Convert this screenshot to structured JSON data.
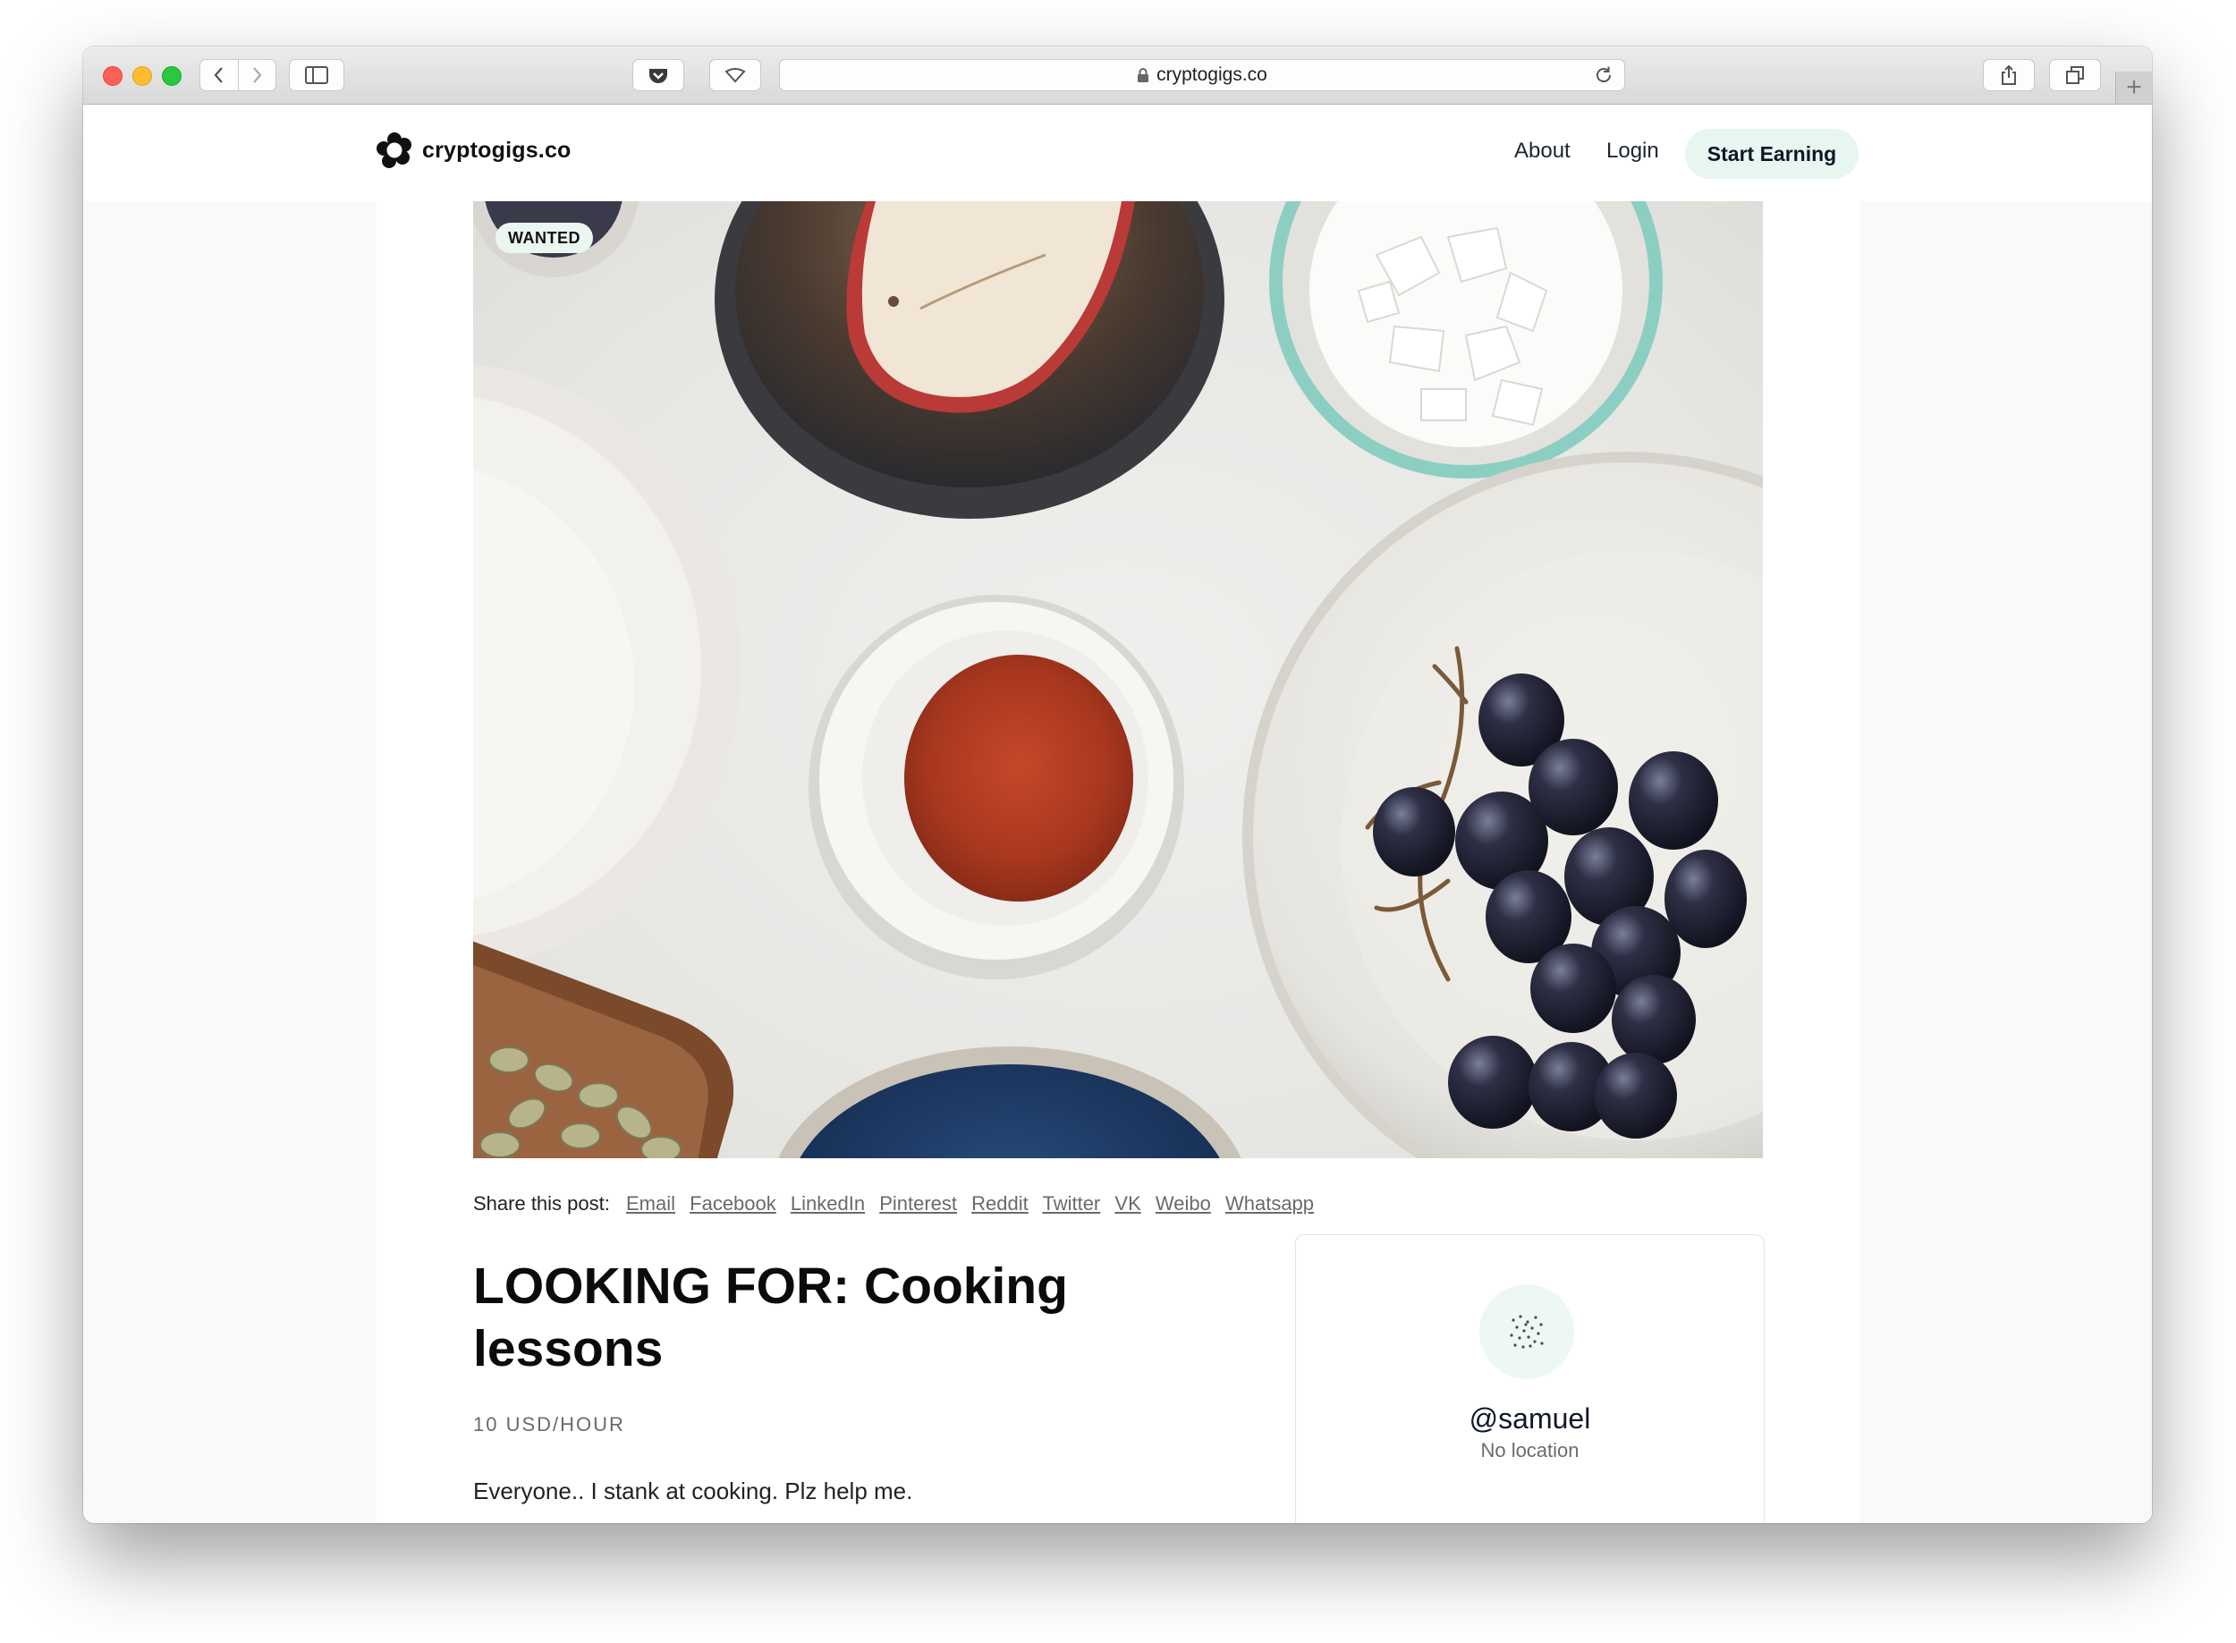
{
  "browser": {
    "url": "cryptogigs.co"
  },
  "header": {
    "logo_text": "cryptogigs.co",
    "nav": {
      "about": "About",
      "login": "Login",
      "start_earning": "Start Earning"
    }
  },
  "hero": {
    "badge": "WANTED"
  },
  "share": {
    "label": "Share this post:",
    "links": [
      "Email",
      "Facebook",
      "LinkedIn",
      "Pinterest",
      "Reddit",
      "Twitter",
      "VK",
      "Weibo",
      "Whatsapp"
    ]
  },
  "post": {
    "title": "LOOKING FOR: Cooking lessons",
    "price": "10 USD/HOUR",
    "description": "Everyone.. I stank at cooking. Plz help me."
  },
  "profile": {
    "username": "@samuel",
    "location": "No location"
  },
  "colors": {
    "accent_bg": "#e7f6f0",
    "badge_bg": "#eaf7f1"
  }
}
